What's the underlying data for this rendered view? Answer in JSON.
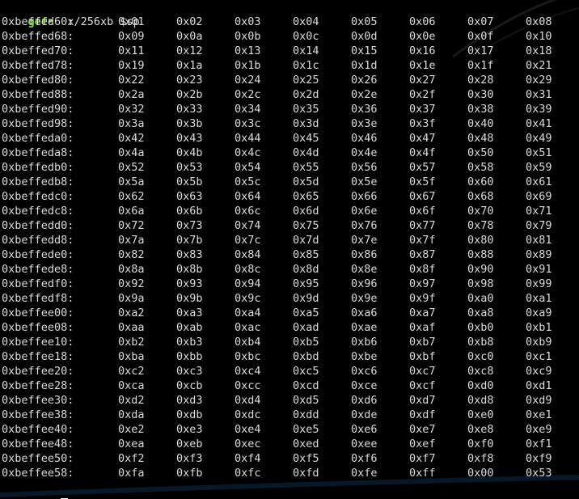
{
  "colors": {
    "background": "#000000",
    "text": "#dcdcdc",
    "prompt": "#8ae234",
    "cursor": "#ffffff"
  },
  "prompt": {
    "label": "gef",
    "arrow": "➤",
    "command": "x/256xb $sp"
  },
  "rows": [
    {
      "addr": "0xbeffed60:",
      "bytes": [
        "0x01",
        "0x02",
        "0x03",
        "0x04",
        "0x05",
        "0x06",
        "0x07",
        "0x08"
      ]
    },
    {
      "addr": "0xbeffed68:",
      "bytes": [
        "0x09",
        "0x0a",
        "0x0b",
        "0x0c",
        "0x0d",
        "0x0e",
        "0x0f",
        "0x10"
      ]
    },
    {
      "addr": "0xbeffed70:",
      "bytes": [
        "0x11",
        "0x12",
        "0x13",
        "0x14",
        "0x15",
        "0x16",
        "0x17",
        "0x18"
      ]
    },
    {
      "addr": "0xbeffed78:",
      "bytes": [
        "0x19",
        "0x1a",
        "0x1b",
        "0x1c",
        "0x1d",
        "0x1e",
        "0x1f",
        "0x21"
      ]
    },
    {
      "addr": "0xbeffed80:",
      "bytes": [
        "0x22",
        "0x23",
        "0x24",
        "0x25",
        "0x26",
        "0x27",
        "0x28",
        "0x29"
      ]
    },
    {
      "addr": "0xbeffed88:",
      "bytes": [
        "0x2a",
        "0x2b",
        "0x2c",
        "0x2d",
        "0x2e",
        "0x2f",
        "0x30",
        "0x31"
      ]
    },
    {
      "addr": "0xbeffed90:",
      "bytes": [
        "0x32",
        "0x33",
        "0x34",
        "0x35",
        "0x36",
        "0x37",
        "0x38",
        "0x39"
      ]
    },
    {
      "addr": "0xbeffed98:",
      "bytes": [
        "0x3a",
        "0x3b",
        "0x3c",
        "0x3d",
        "0x3e",
        "0x3f",
        "0x40",
        "0x41"
      ]
    },
    {
      "addr": "0xbeffeda0:",
      "bytes": [
        "0x42",
        "0x43",
        "0x44",
        "0x45",
        "0x46",
        "0x47",
        "0x48",
        "0x49"
      ]
    },
    {
      "addr": "0xbeffeda8:",
      "bytes": [
        "0x4a",
        "0x4b",
        "0x4c",
        "0x4d",
        "0x4e",
        "0x4f",
        "0x50",
        "0x51"
      ]
    },
    {
      "addr": "0xbeffedb0:",
      "bytes": [
        "0x52",
        "0x53",
        "0x54",
        "0x55",
        "0x56",
        "0x57",
        "0x58",
        "0x59"
      ]
    },
    {
      "addr": "0xbeffedb8:",
      "bytes": [
        "0x5a",
        "0x5b",
        "0x5c",
        "0x5d",
        "0x5e",
        "0x5f",
        "0x60",
        "0x61"
      ]
    },
    {
      "addr": "0xbeffedc0:",
      "bytes": [
        "0x62",
        "0x63",
        "0x64",
        "0x65",
        "0x66",
        "0x67",
        "0x68",
        "0x69"
      ]
    },
    {
      "addr": "0xbeffedc8:",
      "bytes": [
        "0x6a",
        "0x6b",
        "0x6c",
        "0x6d",
        "0x6e",
        "0x6f",
        "0x70",
        "0x71"
      ]
    },
    {
      "addr": "0xbeffedd0:",
      "bytes": [
        "0x72",
        "0x73",
        "0x74",
        "0x75",
        "0x76",
        "0x77",
        "0x78",
        "0x79"
      ]
    },
    {
      "addr": "0xbeffedd8:",
      "bytes": [
        "0x7a",
        "0x7b",
        "0x7c",
        "0x7d",
        "0x7e",
        "0x7f",
        "0x80",
        "0x81"
      ]
    },
    {
      "addr": "0xbeffede0:",
      "bytes": [
        "0x82",
        "0x83",
        "0x84",
        "0x85",
        "0x86",
        "0x87",
        "0x88",
        "0x89"
      ]
    },
    {
      "addr": "0xbeffede8:",
      "bytes": [
        "0x8a",
        "0x8b",
        "0x8c",
        "0x8d",
        "0x8e",
        "0x8f",
        "0x90",
        "0x91"
      ]
    },
    {
      "addr": "0xbeffedf0:",
      "bytes": [
        "0x92",
        "0x93",
        "0x94",
        "0x95",
        "0x96",
        "0x97",
        "0x98",
        "0x99"
      ]
    },
    {
      "addr": "0xbeffedf8:",
      "bytes": [
        "0x9a",
        "0x9b",
        "0x9c",
        "0x9d",
        "0x9e",
        "0x9f",
        "0xa0",
        "0xa1"
      ]
    },
    {
      "addr": "0xbeffee00:",
      "bytes": [
        "0xa2",
        "0xa3",
        "0xa4",
        "0xa5",
        "0xa6",
        "0xa7",
        "0xa8",
        "0xa9"
      ]
    },
    {
      "addr": "0xbeffee08:",
      "bytes": [
        "0xaa",
        "0xab",
        "0xac",
        "0xad",
        "0xae",
        "0xaf",
        "0xb0",
        "0xb1"
      ]
    },
    {
      "addr": "0xbeffee10:",
      "bytes": [
        "0xb2",
        "0xb3",
        "0xb4",
        "0xb5",
        "0xb6",
        "0xb7",
        "0xb8",
        "0xb9"
      ]
    },
    {
      "addr": "0xbeffee18:",
      "bytes": [
        "0xba",
        "0xbb",
        "0xbc",
        "0xbd",
        "0xbe",
        "0xbf",
        "0xc0",
        "0xc1"
      ]
    },
    {
      "addr": "0xbeffee20:",
      "bytes": [
        "0xc2",
        "0xc3",
        "0xc4",
        "0xc5",
        "0xc6",
        "0xc7",
        "0xc8",
        "0xc9"
      ]
    },
    {
      "addr": "0xbeffee28:",
      "bytes": [
        "0xca",
        "0xcb",
        "0xcc",
        "0xcd",
        "0xce",
        "0xcf",
        "0xd0",
        "0xd1"
      ]
    },
    {
      "addr": "0xbeffee30:",
      "bytes": [
        "0xd2",
        "0xd3",
        "0xd4",
        "0xd5",
        "0xd6",
        "0xd7",
        "0xd8",
        "0xd9"
      ]
    },
    {
      "addr": "0xbeffee38:",
      "bytes": [
        "0xda",
        "0xdb",
        "0xdc",
        "0xdd",
        "0xde",
        "0xdf",
        "0xe0",
        "0xe1"
      ]
    },
    {
      "addr": "0xbeffee40:",
      "bytes": [
        "0xe2",
        "0xe3",
        "0xe4",
        "0xe5",
        "0xe6",
        "0xe7",
        "0xe8",
        "0xe9"
      ]
    },
    {
      "addr": "0xbeffee48:",
      "bytes": [
        "0xea",
        "0xeb",
        "0xec",
        "0xed",
        "0xee",
        "0xef",
        "0xf0",
        "0xf1"
      ]
    },
    {
      "addr": "0xbeffee50:",
      "bytes": [
        "0xf2",
        "0xf3",
        "0xf4",
        "0xf5",
        "0xf6",
        "0xf7",
        "0xf8",
        "0xf9"
      ]
    },
    {
      "addr": "0xbeffee58:",
      "bytes": [
        "0xfa",
        "0xfb",
        "0xfc",
        "0xfd",
        "0xfe",
        "0xff",
        "0x00",
        "0x53"
      ]
    }
  ]
}
